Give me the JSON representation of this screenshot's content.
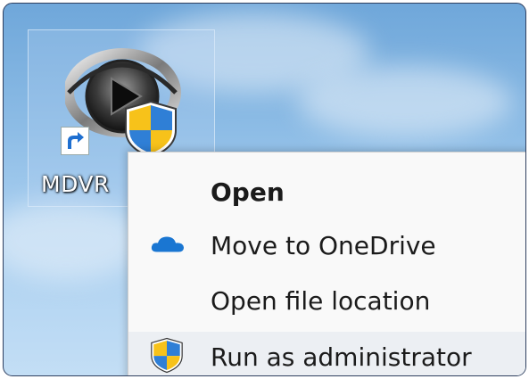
{
  "desktop": {
    "icon_label": "MDVR",
    "icon_name": "media-player-icon",
    "badges": [
      "shortcut-arrow-icon",
      "uac-shield-icon"
    ]
  },
  "context_menu": {
    "items": [
      {
        "label": "Open",
        "icon": null,
        "bold": true
      },
      {
        "label": "Move to OneDrive",
        "icon": "onedrive-cloud-icon",
        "bold": false
      },
      {
        "label": "Open file location",
        "icon": null,
        "bold": false
      },
      {
        "label": "Run as administrator",
        "icon": "uac-shield-icon",
        "bold": false
      }
    ]
  },
  "colors": {
    "accent_cloud": "#1a76d2",
    "shield_blue": "#2f7fd6",
    "shield_yellow": "#f7c21a",
    "menu_bg": "#f9f9f9"
  }
}
